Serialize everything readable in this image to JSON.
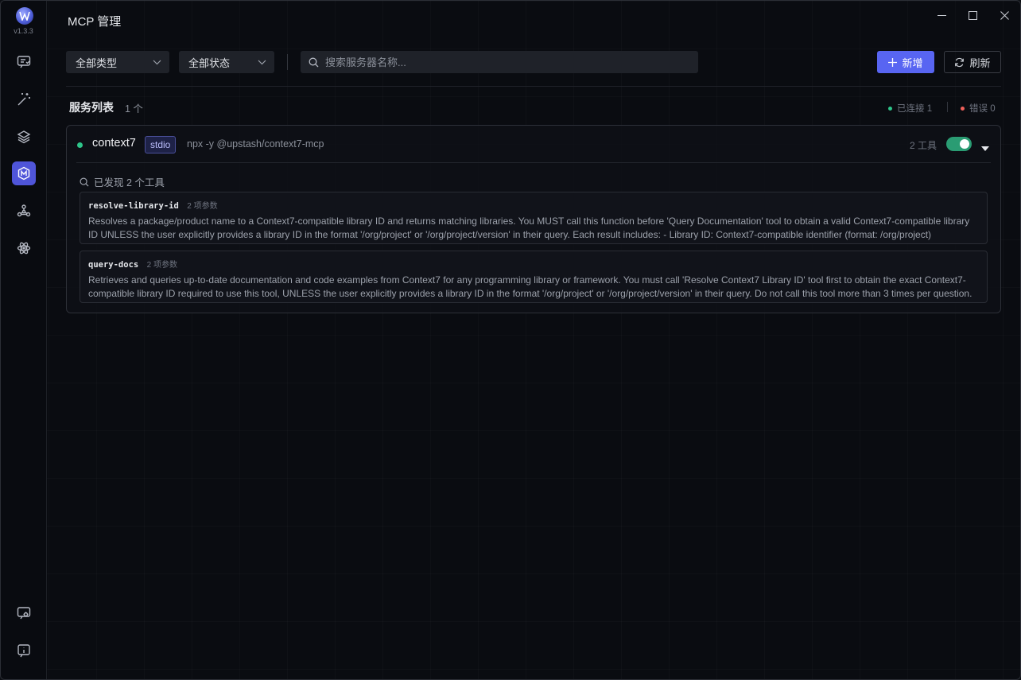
{
  "app": {
    "version": "v1.3.3",
    "title": "MCP 管理"
  },
  "sidebar": {
    "items": [
      {
        "name": "chat-icon",
        "active": false
      },
      {
        "name": "magic-wand-icon",
        "active": false
      },
      {
        "name": "layers-icon",
        "active": false
      },
      {
        "name": "mcp-icon",
        "active": true
      },
      {
        "name": "network-icon",
        "active": false
      },
      {
        "name": "atom-icon",
        "active": false
      }
    ],
    "bottom": [
      {
        "name": "settings-chat-icon"
      },
      {
        "name": "info-icon"
      }
    ]
  },
  "toolbar": {
    "type_filter": "全部类型",
    "status_filter": "全部状态",
    "search_placeholder": "搜索服务器名称...",
    "add_label": "新增",
    "refresh_label": "刷新"
  },
  "list": {
    "title": "服务列表",
    "count": "1 个",
    "connected": "已连接 1",
    "errors": "错误 0"
  },
  "colors": {
    "accent": "#5865f2",
    "connected": "#2ec58a",
    "error": "#f0605a",
    "toggle_on": "#2a9c73"
  },
  "server": {
    "name": "context7",
    "transport": "stdio",
    "command": "npx -y @upstash/context7-mcp",
    "tool_count": "2 工具",
    "enabled": true,
    "discovered": "已发现 2 个工具",
    "tools": [
      {
        "name": "resolve-library-id",
        "params": "2 项参数",
        "description": "Resolves a package/product name to a Context7-compatible library ID and returns matching libraries. You MUST call this function before 'Query Documentation' tool to obtain a valid Context7-compatible library ID UNLESS the user explicitly provides a library ID in the format '/org/project' or '/org/project/version' in their query. Each result includes: - Library ID: Context7-compatible identifier (format: /org/project)"
      },
      {
        "name": "query-docs",
        "params": "2 项参数",
        "description": "Retrieves and queries up-to-date documentation and code examples from Context7 for any programming library or framework. You must call 'Resolve Context7 Library ID' tool first to obtain the exact Context7-compatible library ID required to use this tool, UNLESS the user explicitly provides a library ID in the format '/org/project' or '/org/project/version' in their query. Do not call this tool more than 3 times per question."
      }
    ]
  }
}
